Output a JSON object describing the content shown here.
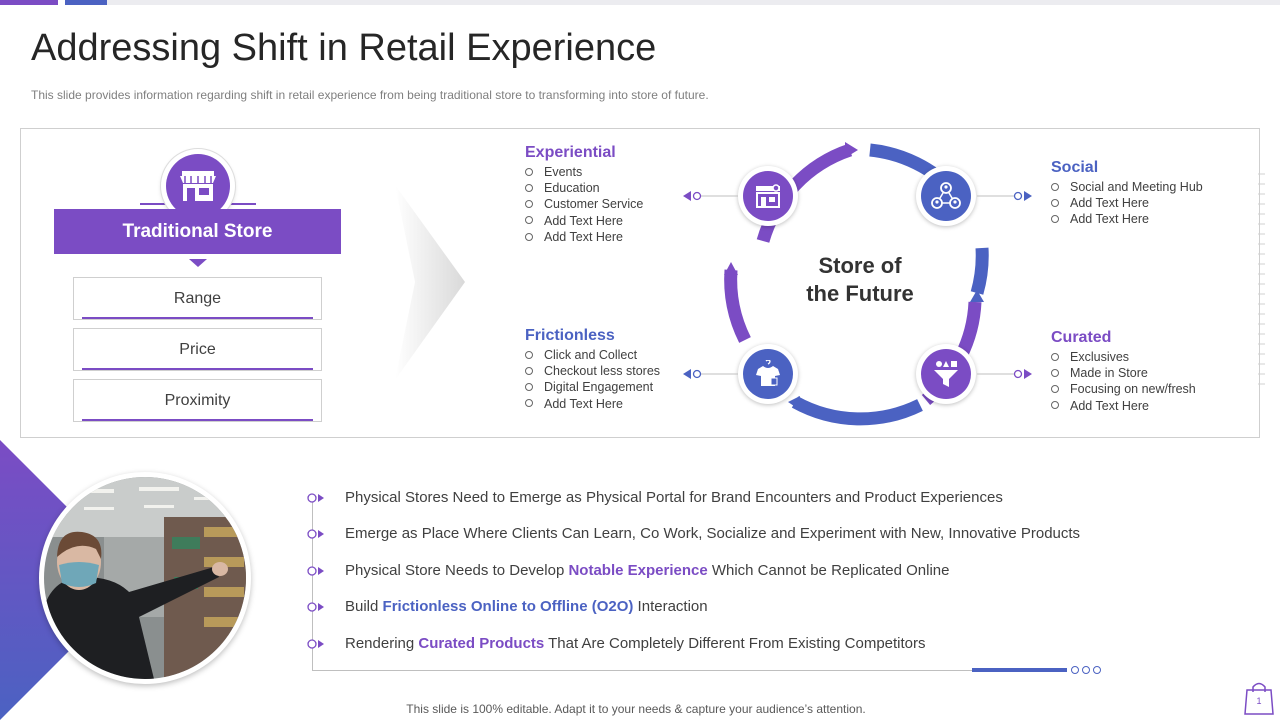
{
  "title": "Addressing Shift in Retail Experience",
  "subtitle": "This slide provides  information  regarding  shift in retail experience  from being traditional store to transforming  into store of future.",
  "traditional_store": {
    "label": "Traditional Store",
    "icon": "store-icon",
    "items": [
      "Range",
      "Price",
      "Proximity"
    ]
  },
  "center": {
    "line1": "Store of",
    "line2": "the Future"
  },
  "quadrants": {
    "experiential": {
      "title": "Experiential",
      "color": "#7b4cc4",
      "icon": "store-front-icon",
      "items": [
        "Events",
        "Education",
        "Customer Service",
        "Add Text Here",
        "Add Text Here"
      ]
    },
    "social": {
      "title": "Social",
      "color": "#4b62c2",
      "icon": "people-network-icon",
      "items": [
        "Social and Meeting Hub",
        "Add Text Here",
        "Add Text Here"
      ]
    },
    "frictionless": {
      "title": "Frictionless",
      "color": "#4b62c2",
      "icon": "shirt-tag-icon",
      "items": [
        "Click and Collect",
        "Checkout less stores",
        "Digital Engagement",
        "Add Text Here"
      ]
    },
    "curated": {
      "title": "Curated",
      "color": "#7b4cc4",
      "icon": "funnel-icon",
      "items": [
        "Exclusives",
        "Made in Store",
        "Focusing on new/fresh",
        "Add Text Here"
      ]
    }
  },
  "bullets": [
    {
      "pre": "Physical Stores Need to Emerge as Physical Portal for Brand Encounters and Product Experiences",
      "hl": "",
      "post": ""
    },
    {
      "pre": "Emerge as Place Where Clients Can Learn, Co Work, Socialize and Experiment with New, Innovative Products",
      "hl": "",
      "post": ""
    },
    {
      "pre": "Physical Store Needs to Develop ",
      "hl": "Notable Experience",
      "post": " Which Cannot be Replicated Online"
    },
    {
      "pre": "Build ",
      "hl": "Frictionless Online to Offline (O2O)",
      "post": " Interaction"
    },
    {
      "pre": "Rendering ",
      "hl": "Curated Products",
      "post": " That Are Completely Different From Existing Competitors"
    }
  ],
  "footer": "This slide is 100% editable. Adapt it to your needs & capture your audience’s attention.",
  "page_number": "1",
  "colors": {
    "purple": "#7b4cc4",
    "blue": "#4b62c2"
  }
}
